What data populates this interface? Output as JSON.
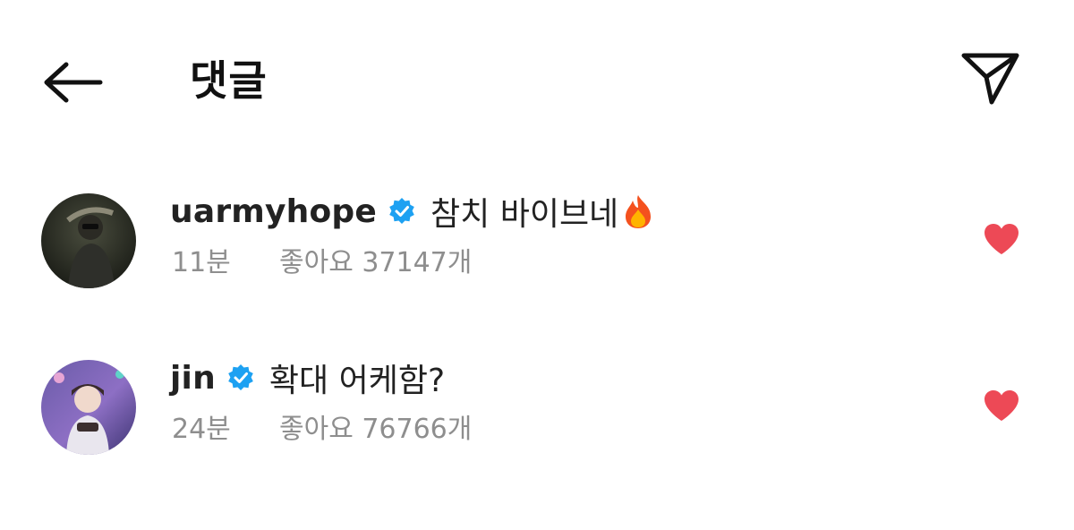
{
  "header": {
    "title": "댓글",
    "back_icon": "arrow-left-icon",
    "share_icon": "paper-plane-icon"
  },
  "comments": [
    {
      "username": "uarmyhope",
      "verified": true,
      "text": "참치 바이브네",
      "emoji": "fire-emoji",
      "time": "11분",
      "likes": "좋아요 37147개",
      "liked": true
    },
    {
      "username": "jin",
      "verified": true,
      "text": "확대 어케함?",
      "time": "24분",
      "likes": "좋아요 76766개",
      "liked": true
    }
  ],
  "colors": {
    "verified": "#1da1f2",
    "heart": "#ed4956",
    "meta_text": "#8e8e8e"
  }
}
